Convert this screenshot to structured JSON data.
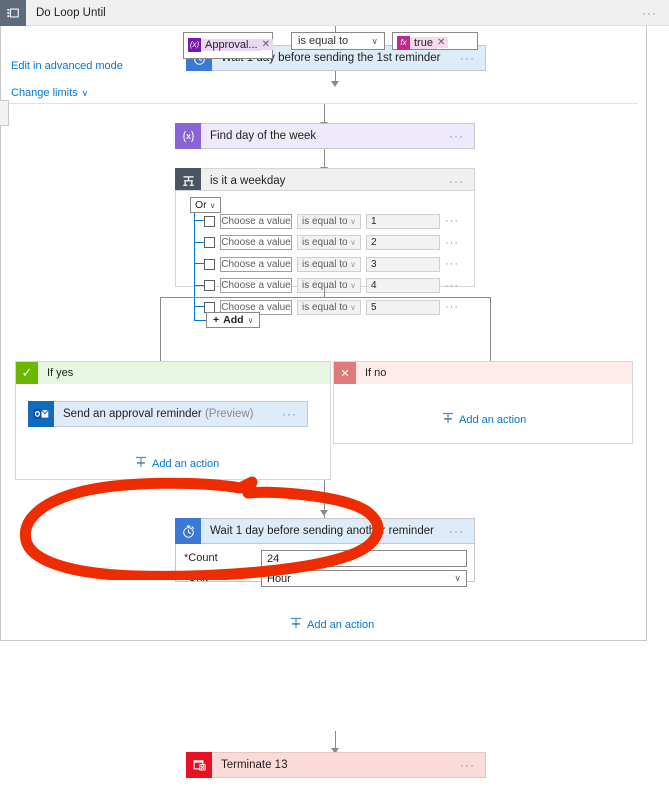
{
  "colors": {
    "node_blue_bg": "#deecf9",
    "node_blue_icon": "#3b78d8",
    "purple_icon": "#8764d8",
    "purple_bg": "#eeeafb",
    "cond_icon": "#4a5560",
    "scope_icon": "#5d6b7d",
    "yes_green": "#6bb700",
    "no_red": "#e07a7a",
    "terminate_red": "#e81123",
    "terminate_bg": "#fbdada",
    "link_blue": "#0078d4",
    "annotation_red": "#ef2b00"
  },
  "top_node": {
    "title": "Wait 1 day before sending the 1st reminder",
    "icon": "delay-clock-icon",
    "overflow": "···"
  },
  "loop": {
    "title": "Do Loop Until",
    "icon": "scope-loop-icon",
    "overflow": "···",
    "condition": {
      "left_token": {
        "icon_glyph": "(x)",
        "label": "Approval...",
        "remove": "✕"
      },
      "operator": {
        "value": "is equal to",
        "chevron": "∨"
      },
      "right_token": {
        "icon_glyph": "fx",
        "label": "true",
        "remove": "✕"
      }
    },
    "advanced_link": "Edit in advanced mode",
    "change_limits_link": "Change limits",
    "change_limits_chevron": "∨"
  },
  "find_day_node": {
    "title": "Find day of the week",
    "icon": "compose-expression-icon",
    "overflow": "···"
  },
  "condition_card": {
    "title": "is it a weekday",
    "icon": "condition-fork-icon",
    "overflow": "···",
    "group_operator": "Or",
    "group_chevron": "∨",
    "column_placeholders": {
      "field": "Choose a value",
      "operator": "is equal to"
    },
    "rows": [
      {
        "field": "Choose a value",
        "operator": "is equal to",
        "value": "1",
        "overflow": "···"
      },
      {
        "field": "Choose a value",
        "operator": "is equal to",
        "value": "2",
        "overflow": "···"
      },
      {
        "field": "Choose a value",
        "operator": "is equal to",
        "value": "3",
        "overflow": "···"
      },
      {
        "field": "Choose a value",
        "operator": "is equal to",
        "value": "4",
        "overflow": "···"
      },
      {
        "field": "Choose a value",
        "operator": "is equal to",
        "value": "5",
        "overflow": "···"
      }
    ],
    "add_button": {
      "plus": "+",
      "label": "Add",
      "chevron": "∨"
    }
  },
  "branches": {
    "yes": {
      "label": "If yes",
      "icon": "checkmark-icon",
      "icon_glyph": "✓",
      "action": {
        "title": "Send an approval reminder",
        "suffix": "(Preview)",
        "icon": "outlook-icon",
        "overflow": "···"
      },
      "add_action": "Add an action"
    },
    "no": {
      "label": "If no",
      "icon": "cross-icon",
      "icon_glyph": "✕",
      "add_action": "Add an action"
    }
  },
  "wait_node": {
    "title": "Wait 1 day before sending another reminder",
    "icon": "delay-clock-icon",
    "overflow": "···",
    "params": [
      {
        "label": "Count",
        "required": "*",
        "value": "24",
        "type": "text"
      },
      {
        "label": "Unit",
        "required": "*",
        "value": "Hour",
        "type": "select",
        "chevron": "∨"
      }
    ]
  },
  "loop_add_action": "Add an action",
  "terminate_node": {
    "title": "Terminate 13",
    "icon": "terminate-icon",
    "overflow": "···"
  },
  "annotation": {
    "shape": "red-ellipse-highlight",
    "target": "Send an approval reminder"
  }
}
